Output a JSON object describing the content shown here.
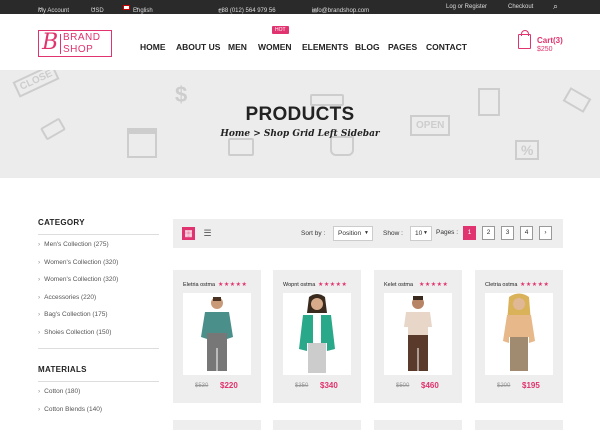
{
  "topbar": {
    "account": "My Account",
    "currency": "USD",
    "language": "English",
    "phone": "+88 (012) 564 979 56",
    "email": "info@brandshop.com",
    "login": "Log or Register",
    "checkout": "Checkout"
  },
  "logo": {
    "initial": "B",
    "line1": "BRAND",
    "line2": "SHOP"
  },
  "nav": {
    "items": [
      "HOME",
      "ABOUT US",
      "MEN",
      "WOMEN",
      "ELEMENTS",
      "BLOG",
      "PAGES",
      "CONTACT"
    ],
    "hot_badge": "HOT"
  },
  "cart": {
    "label": "Cart(3)",
    "total": "$250"
  },
  "banner": {
    "title": "PRODUCTS",
    "breadcrumb": "Home > Shop Grid Left Sidebar",
    "decor": {
      "close": "CLOSE",
      "open": "OPEN",
      "discount": "%",
      "dollar": "$"
    }
  },
  "sidebar": {
    "category_title": "CATEGORY",
    "categories": [
      "Men's Collection (275)",
      "Women's Collection (320)",
      "Women's Collection (320)",
      "Accessories (220)",
      "Bag's Collection (175)",
      "Shoies Collection (150)"
    ],
    "materials_title": "MATERIALS",
    "materials": [
      "Cotton (180)",
      "Cotton Blends (140)"
    ]
  },
  "toolbar": {
    "sort_label": "Sort by :",
    "sort_value": "Position",
    "show_label": "Show :",
    "show_value": "10",
    "pages_label": "Pages :",
    "pages": [
      "1",
      "2",
      "3",
      "4"
    ],
    "next": "›"
  },
  "products": [
    {
      "name": "Eletria ostma",
      "stars": "★★★★★",
      "old_price": "$530",
      "price": "$220",
      "shirt_color": "#4a8f8a"
    },
    {
      "name": "Wopnt ostma",
      "stars": "★★★★★",
      "old_price": "$350",
      "price": "$340",
      "shirt_color": "#2aa88a"
    },
    {
      "name": "Kelet ostma",
      "stars": "★★★★★",
      "old_price": "$500",
      "price": "$460",
      "shirt_color": "#e8d6c8"
    },
    {
      "name": "Cletria ostma",
      "stars": "★★★★★",
      "old_price": "$200",
      "price": "$195",
      "shirt_color": "#e6b88a"
    }
  ],
  "colors": {
    "accent": "#e0336f",
    "topbar": "#2a2a2a",
    "banner": "#ececec"
  }
}
